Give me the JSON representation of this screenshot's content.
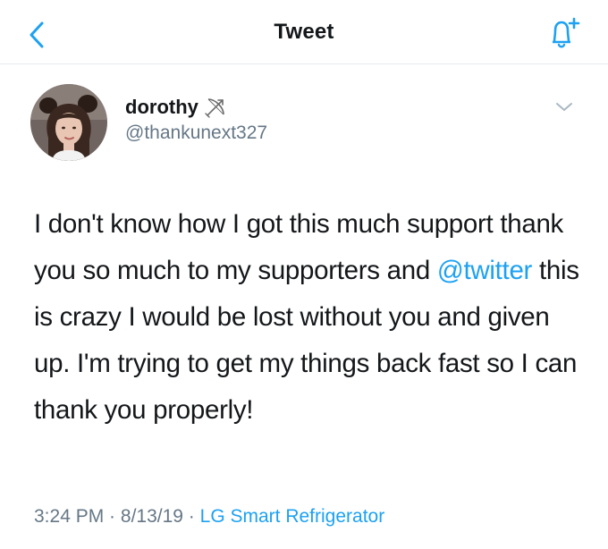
{
  "header": {
    "title": "Tweet"
  },
  "author": {
    "display_name": "dorothy",
    "handle": "@thankunext327"
  },
  "tweet": {
    "text_before": "I don't know how I got this much support thank you so much to my supporters and ",
    "mention": "@twitter",
    "text_after": " this is crazy I would be lost without you and given up. I'm trying to get my things back fast so I can thank you properly!"
  },
  "meta": {
    "time": "3:24 PM",
    "sep1": " · ",
    "date": "8/13/19",
    "sep2": " · ",
    "source": "LG Smart Refrigerator"
  },
  "colors": {
    "accent": "#1da1f2",
    "text": "#14171a",
    "secondary": "#657786"
  },
  "icons": {
    "back": "chevron-left-icon",
    "notify": "bell-plus-icon",
    "emoji": "bow-and-arrow-icon",
    "more": "chevron-down-icon"
  }
}
